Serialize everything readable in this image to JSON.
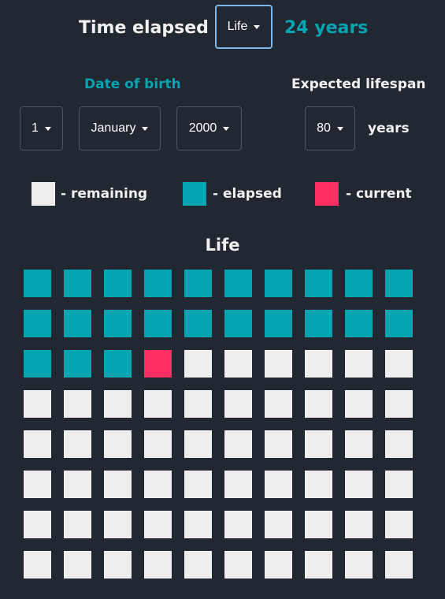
{
  "header": {
    "title": "Time elapsed",
    "period_select": "Life",
    "elapsed_value": "24 years"
  },
  "birth": {
    "label": "Date of birth",
    "day": "1",
    "month": "January",
    "year": "2000"
  },
  "lifespan": {
    "label": "Expected lifespan",
    "value": "80",
    "unit": "years"
  },
  "legend": {
    "remaining": "- remaining",
    "elapsed": "- elapsed",
    "current": "- current"
  },
  "colors": {
    "background": "#222831",
    "elapsed": "#06a3b0",
    "current": "#ff2e63",
    "remaining": "#eeeeee"
  },
  "grid": {
    "title": "Life",
    "total_units": 80,
    "elapsed_units": 23,
    "current_unit_index": 23
  }
}
